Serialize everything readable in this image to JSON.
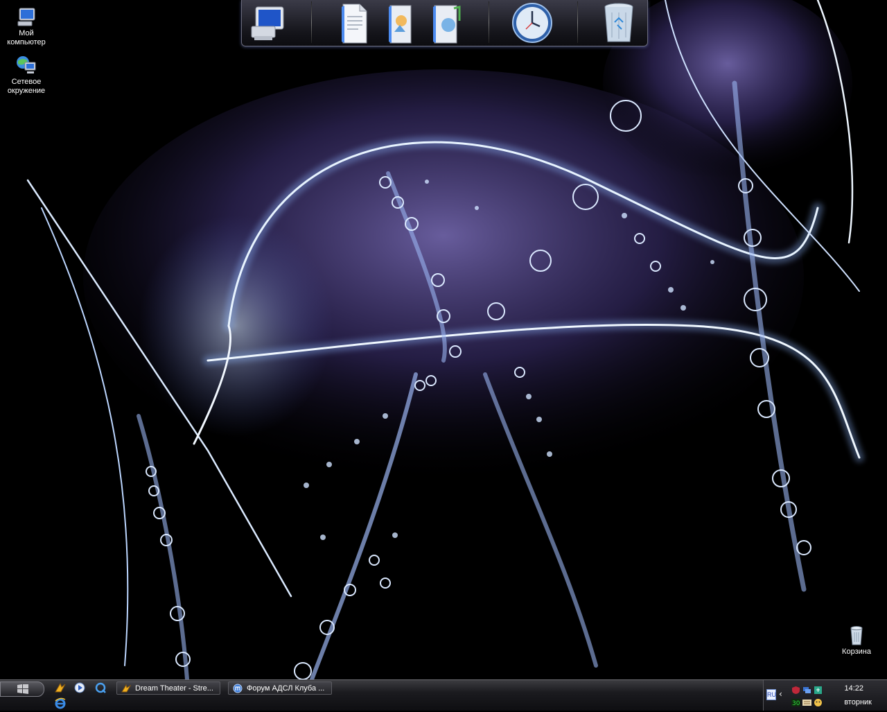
{
  "desktop": {
    "icons": [
      {
        "label_line1": "Мой",
        "label_line2": "компьютер",
        "icon": "my-computer-icon"
      },
      {
        "label_line1": "Сетевое",
        "label_line2": "окружение",
        "icon": "network-places-icon"
      },
      {
        "label_line1": "Корзина",
        "label_line2": "",
        "icon": "recycle-bin-icon"
      }
    ]
  },
  "dock": {
    "items": [
      "computer-icon",
      "document-icon",
      "pictures-folder-icon",
      "music-folder-icon",
      "clock-icon",
      "trash-icon"
    ]
  },
  "taskbar": {
    "quick_launch": [
      "winamp-icon",
      "media-player-icon",
      "qip-icon",
      "internet-explorer-icon"
    ],
    "tasks": [
      {
        "label": "Dream Theater - Stre...",
        "icon": "winamp-icon"
      },
      {
        "label": "Форум АДСЛ Клуба ...",
        "icon": "browser-icon"
      }
    ],
    "tray": {
      "language": "RU",
      "time": "14:22",
      "day": "вторник"
    }
  },
  "colors": {
    "accent_glow": "#9fc8ff",
    "purple": "#5a4a9a",
    "taskbar": "#1b1b1f"
  }
}
